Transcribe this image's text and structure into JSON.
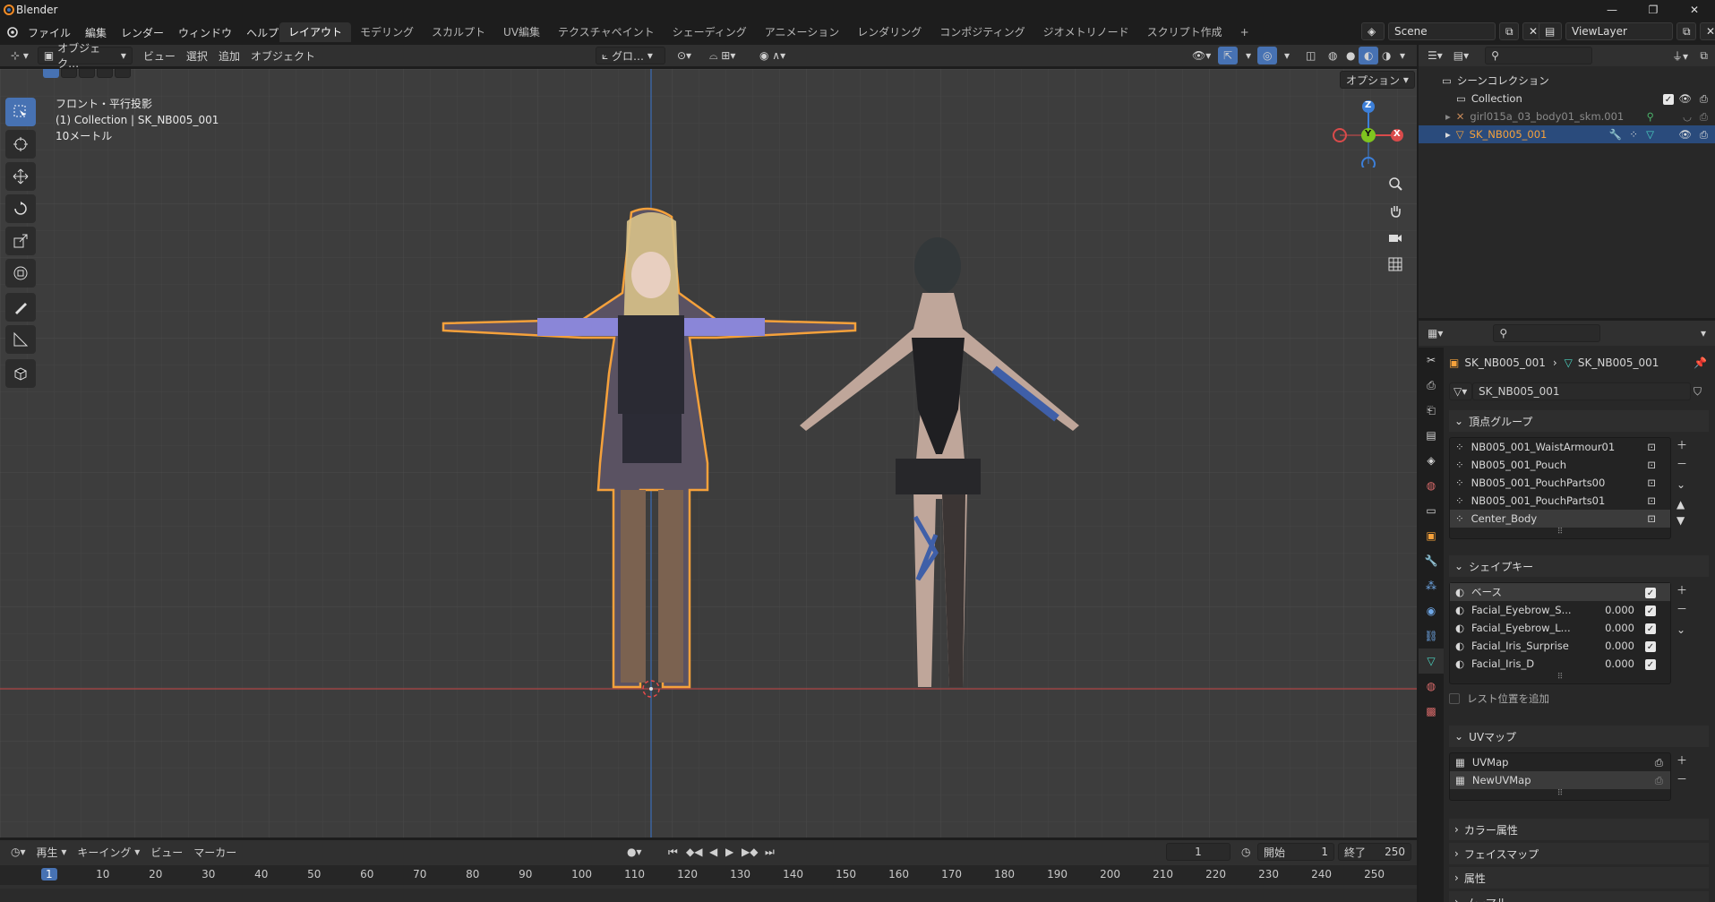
{
  "window": {
    "title": "Blender",
    "controls": [
      "—",
      "❐",
      "✕"
    ]
  },
  "menu": {
    "items": [
      "ファイル",
      "編集",
      "レンダー",
      "ウィンドウ",
      "ヘルプ"
    ]
  },
  "workspaces": {
    "tabs": [
      "レイアウト",
      "モデリング",
      "スカルプト",
      "UV編集",
      "テクスチャペイント",
      "シェーディング",
      "アニメーション",
      "レンダリング",
      "コンポジティング",
      "ジオメトリノード",
      "スクリプト作成"
    ],
    "active": 0,
    "add": "+"
  },
  "scene": {
    "name": "Scene",
    "view_layer": "ViewLayer"
  },
  "viewport_header": {
    "mode": "オブジェク…",
    "menus": [
      "ビュー",
      "選択",
      "追加",
      "オブジェクト"
    ],
    "transform": "グロ…",
    "options": "オプション"
  },
  "viewport": {
    "line1": "フロント・平行投影",
    "line2": "(1) Collection | SK_NB005_001",
    "line3": "10メートル",
    "gizmo": {
      "z": "Z",
      "y": "Y",
      "x": "X"
    }
  },
  "outliner": {
    "root": "シーンコレクション",
    "rows": [
      {
        "name": "Collection"
      },
      {
        "name": "girl015a_03_body01_skm.001"
      },
      {
        "name": "SK_NB005_001"
      }
    ]
  },
  "properties": {
    "breadcrumb_object": "SK_NB005_001",
    "breadcrumb_data": "SK_NB005_001",
    "mesh_name": "SK_NB005_001",
    "vertex_groups": {
      "title": "頂点グループ",
      "items": [
        "NB005_001_WaistArmour01",
        "NB005_001_Pouch",
        "NB005_001_PouchParts00",
        "NB005_001_PouchParts01",
        "Center_Body"
      ]
    },
    "shape_keys": {
      "title": "シェイプキー",
      "items": [
        {
          "name": "ベース",
          "value": ""
        },
        {
          "name": "Facial_Eyebrow_S...",
          "value": "0.000"
        },
        {
          "name": "Facial_Eyebrow_L...",
          "value": "0.000"
        },
        {
          "name": "Facial_Iris_Surprise",
          "value": "0.000"
        },
        {
          "name": "Facial_Iris_D",
          "value": "0.000"
        }
      ],
      "rest_label": "レスト位置を追加"
    },
    "uv_maps": {
      "title": "UVマップ",
      "items": [
        "UVMap",
        "NewUVMap"
      ]
    },
    "collapsed": [
      "カラー属性",
      "フェイスマップ",
      "属性",
      "ノーマル"
    ]
  },
  "timeline": {
    "menus": [
      "再生",
      "キーイング",
      "ビュー",
      "マーカー"
    ],
    "current_frame": "1",
    "start_label": "開始",
    "start": "1",
    "end_label": "終了",
    "end": "250",
    "ticks": [
      "1",
      "10",
      "20",
      "30",
      "40",
      "50",
      "60",
      "70",
      "80",
      "90",
      "100",
      "110",
      "120",
      "130",
      "140",
      "150",
      "160",
      "170",
      "180",
      "190",
      "200",
      "210",
      "220",
      "230",
      "240",
      "250"
    ]
  },
  "colors": {
    "accent": "#4772b3",
    "selection_orange": "#f5a13b",
    "x_axis": "#d94b4b",
    "y_axis": "#7fc41f",
    "z_axis": "#3c7fd9"
  }
}
